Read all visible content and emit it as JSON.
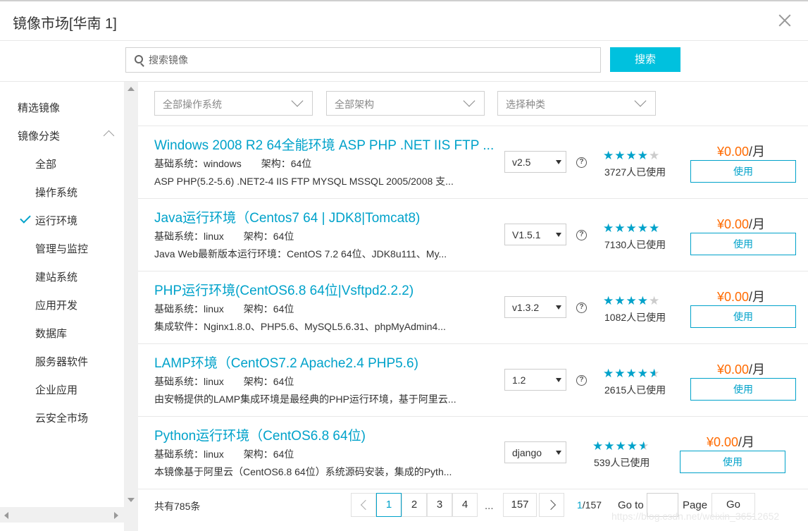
{
  "dialog": {
    "title": "镜像市场[华南 1]"
  },
  "search": {
    "placeholder": "搜索镜像",
    "button_label": "搜索"
  },
  "sidebar": {
    "featured": "精选镜像",
    "category_header": "镜像分类",
    "items": [
      {
        "label": "全部",
        "selected": false
      },
      {
        "label": "操作系统",
        "selected": false
      },
      {
        "label": "运行环境",
        "selected": true
      },
      {
        "label": "管理与监控",
        "selected": false
      },
      {
        "label": "建站系统",
        "selected": false
      },
      {
        "label": "应用开发",
        "selected": false
      },
      {
        "label": "数据库",
        "selected": false
      },
      {
        "label": "服务器软件",
        "selected": false
      },
      {
        "label": "企业应用",
        "selected": false
      },
      {
        "label": "云安全市场",
        "selected": false
      }
    ]
  },
  "filters": {
    "os": "全部操作系统",
    "arch": "全部架构",
    "type": "选择种类"
  },
  "products": [
    {
      "title": "Windows 2008 R2 64全能环境 ASP PHP .NET IIS FTP ...",
      "os_label": "基础系统：windows",
      "arch_label": "架构：64位",
      "description": "ASP PHP(5.2-5.6) .NET2-4 IIS FTP MYSQL MSSQL 2005/2008 支...",
      "version": "v2.5",
      "rating": 4,
      "users": "3727人已使用",
      "price_amount": "¥0.00",
      "price_unit": "/月",
      "button": "使用"
    },
    {
      "title": "Java运行环境（Centos7 64 | JDK8|Tomcat8)",
      "os_label": "基础系统：linux",
      "arch_label": "架构：64位",
      "description": "Java Web最新版本运行环境：CentOS 7.2 64位、JDK8u111、My...",
      "version": "V1.5.1",
      "rating": 5,
      "users": "7130人已使用",
      "price_amount": "¥0.00",
      "price_unit": "/月",
      "button": "使用"
    },
    {
      "title": "PHP运行环境(CentOS6.8 64位|Vsftpd2.2.2)",
      "os_label": "基础系统：linux",
      "arch_label": "架构：64位",
      "description": "集成软件：Nginx1.8.0、PHP5.6、MySQL5.6.31、phpMyAdmin4...",
      "version": "v1.3.2",
      "rating": 4,
      "users": "1082人已使用",
      "price_amount": "¥0.00",
      "price_unit": "/月",
      "button": "使用"
    },
    {
      "title": "LAMP环境（CentOS7.2 Apache2.4 PHP5.6)",
      "os_label": "基础系统：linux",
      "arch_label": "架构：64位",
      "description": "由安畅提供的LAMP集成环境是最经典的PHP运行环境，基于阿里云...",
      "version": "1.2",
      "rating": 4.5,
      "users": "2615人已使用",
      "price_amount": "¥0.00",
      "price_unit": "/月",
      "button": "使用"
    },
    {
      "title": "Python运行环境（CentOS6.8 64位)",
      "os_label": "基础系统：linux",
      "arch_label": "架构：64位",
      "description": "本镜像基于阿里云（CentOS6.8 64位）系统源码安装，集成的Pyth...",
      "version": "django",
      "rating": 4.5,
      "users": "539人已使用",
      "price_amount": "¥0.00",
      "price_unit": "/月",
      "button": "使用"
    }
  ],
  "pagination": {
    "total": "共有785条",
    "pages": [
      "1",
      "2",
      "3",
      "4"
    ],
    "ellipsis": "...",
    "last_page": "157",
    "current": "1",
    "of_total": "/157",
    "goto_label": "Go to",
    "page_label": "Page",
    "go_button": "Go"
  },
  "watermark": "https://blog.csdn.net/weixin_36512652",
  "colors": {
    "accent": "#00a2ca",
    "search_button": "#00c1de",
    "price": "#ff6a00"
  }
}
